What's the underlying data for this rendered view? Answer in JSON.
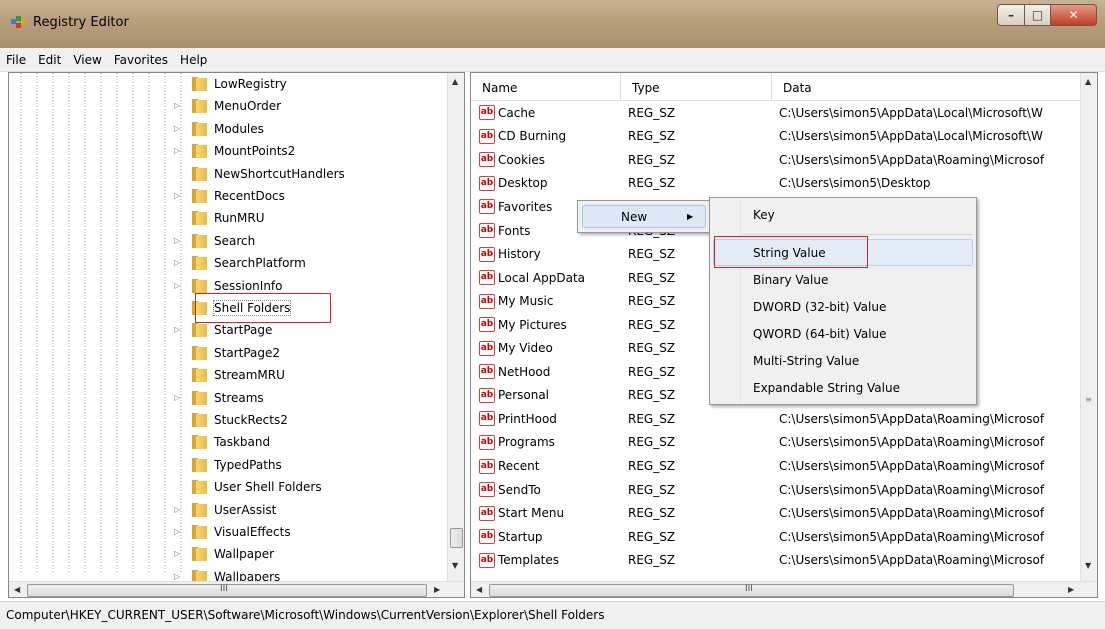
{
  "window": {
    "title": "Registry Editor"
  },
  "menu": [
    "File",
    "Edit",
    "View",
    "Favorites",
    "Help"
  ],
  "tree": {
    "items": [
      {
        "label": "LowRegistry",
        "expandable": false
      },
      {
        "label": "MenuOrder",
        "expandable": true
      },
      {
        "label": "Modules",
        "expandable": true
      },
      {
        "label": "MountPoints2",
        "expandable": true
      },
      {
        "label": "NewShortcutHandlers",
        "expandable": false
      },
      {
        "label": "RecentDocs",
        "expandable": true
      },
      {
        "label": "RunMRU",
        "expandable": false
      },
      {
        "label": "Search",
        "expandable": true
      },
      {
        "label": "SearchPlatform",
        "expandable": true
      },
      {
        "label": "SessionInfo",
        "expandable": true
      },
      {
        "label": "Shell Folders",
        "expandable": false,
        "selected": true
      },
      {
        "label": "StartPage",
        "expandable": true
      },
      {
        "label": "StartPage2",
        "expandable": false
      },
      {
        "label": "StreamMRU",
        "expandable": false
      },
      {
        "label": "Streams",
        "expandable": true
      },
      {
        "label": "StuckRects2",
        "expandable": false
      },
      {
        "label": "Taskband",
        "expandable": false
      },
      {
        "label": "TypedPaths",
        "expandable": false
      },
      {
        "label": "User Shell Folders",
        "expandable": false
      },
      {
        "label": "UserAssist",
        "expandable": true
      },
      {
        "label": "VisualEffects",
        "expandable": true
      },
      {
        "label": "Wallpaper",
        "expandable": true
      },
      {
        "label": "Wallpapers",
        "expandable": true
      }
    ],
    "hscroll_grip": "III"
  },
  "list": {
    "columns": [
      "Name",
      "Type",
      "Data"
    ],
    "rows": [
      {
        "name": "Cache",
        "type": "REG_SZ",
        "data": "C:\\Users\\simon5\\AppData\\Local\\Microsoft\\W"
      },
      {
        "name": "CD Burning",
        "type": "REG_SZ",
        "data": "C:\\Users\\simon5\\AppData\\Local\\Microsoft\\W"
      },
      {
        "name": "Cookies",
        "type": "REG_SZ",
        "data": "C:\\Users\\simon5\\AppData\\Roaming\\Microsof"
      },
      {
        "name": "Desktop",
        "type": "REG_SZ",
        "data": "C:\\Users\\simon5\\Desktop"
      },
      {
        "name": "Favorites",
        "type": "",
        "data": ""
      },
      {
        "name": "Fonts",
        "type": "REG_SZ",
        "data": ""
      },
      {
        "name": "History",
        "type": "REG_SZ",
        "data": "tal\\Microsoft\\W"
      },
      {
        "name": "Local AppData",
        "type": "REG_SZ",
        "data": "al"
      },
      {
        "name": "My Music",
        "type": "REG_SZ",
        "data": ""
      },
      {
        "name": "My Pictures",
        "type": "REG_SZ",
        "data": ""
      },
      {
        "name": "My Video",
        "type": "REG_SZ",
        "data": ""
      },
      {
        "name": "NetHood",
        "type": "REG_SZ",
        "data": "aming\\Microsof"
      },
      {
        "name": "Personal",
        "type": "REG_SZ",
        "data": ""
      },
      {
        "name": "PrintHood",
        "type": "REG_SZ",
        "data": "C:\\Users\\simon5\\AppData\\Roaming\\Microsof"
      },
      {
        "name": "Programs",
        "type": "REG_SZ",
        "data": "C:\\Users\\simon5\\AppData\\Roaming\\Microsof"
      },
      {
        "name": "Recent",
        "type": "REG_SZ",
        "data": "C:\\Users\\simon5\\AppData\\Roaming\\Microsof"
      },
      {
        "name": "SendTo",
        "type": "REG_SZ",
        "data": "C:\\Users\\simon5\\AppData\\Roaming\\Microsof"
      },
      {
        "name": "Start Menu",
        "type": "REG_SZ",
        "data": "C:\\Users\\simon5\\AppData\\Roaming\\Microsof"
      },
      {
        "name": "Startup",
        "type": "REG_SZ",
        "data": "C:\\Users\\simon5\\AppData\\Roaming\\Microsof"
      },
      {
        "name": "Templates",
        "type": "REG_SZ",
        "data": "C:\\Users\\simon5\\AppData\\Roaming\\Microsof"
      }
    ],
    "icon_text": "ab",
    "hscroll_grip": "III"
  },
  "context_menu": {
    "new_label": "New",
    "submenu": [
      "Key",
      "String Value",
      "Binary Value",
      "DWORD (32-bit) Value",
      "QWORD (64-bit) Value",
      "Multi-String Value",
      "Expandable String Value"
    ],
    "highlighted": "String Value"
  },
  "status": {
    "path": "Computer\\HKEY_CURRENT_USER\\Software\\Microsoft\\Windows\\CurrentVersion\\Explorer\\Shell Folders"
  },
  "colors": {
    "highlight_box": "#d22222",
    "folder": "#e8bd45",
    "menu_hover": "#dce8f6"
  }
}
